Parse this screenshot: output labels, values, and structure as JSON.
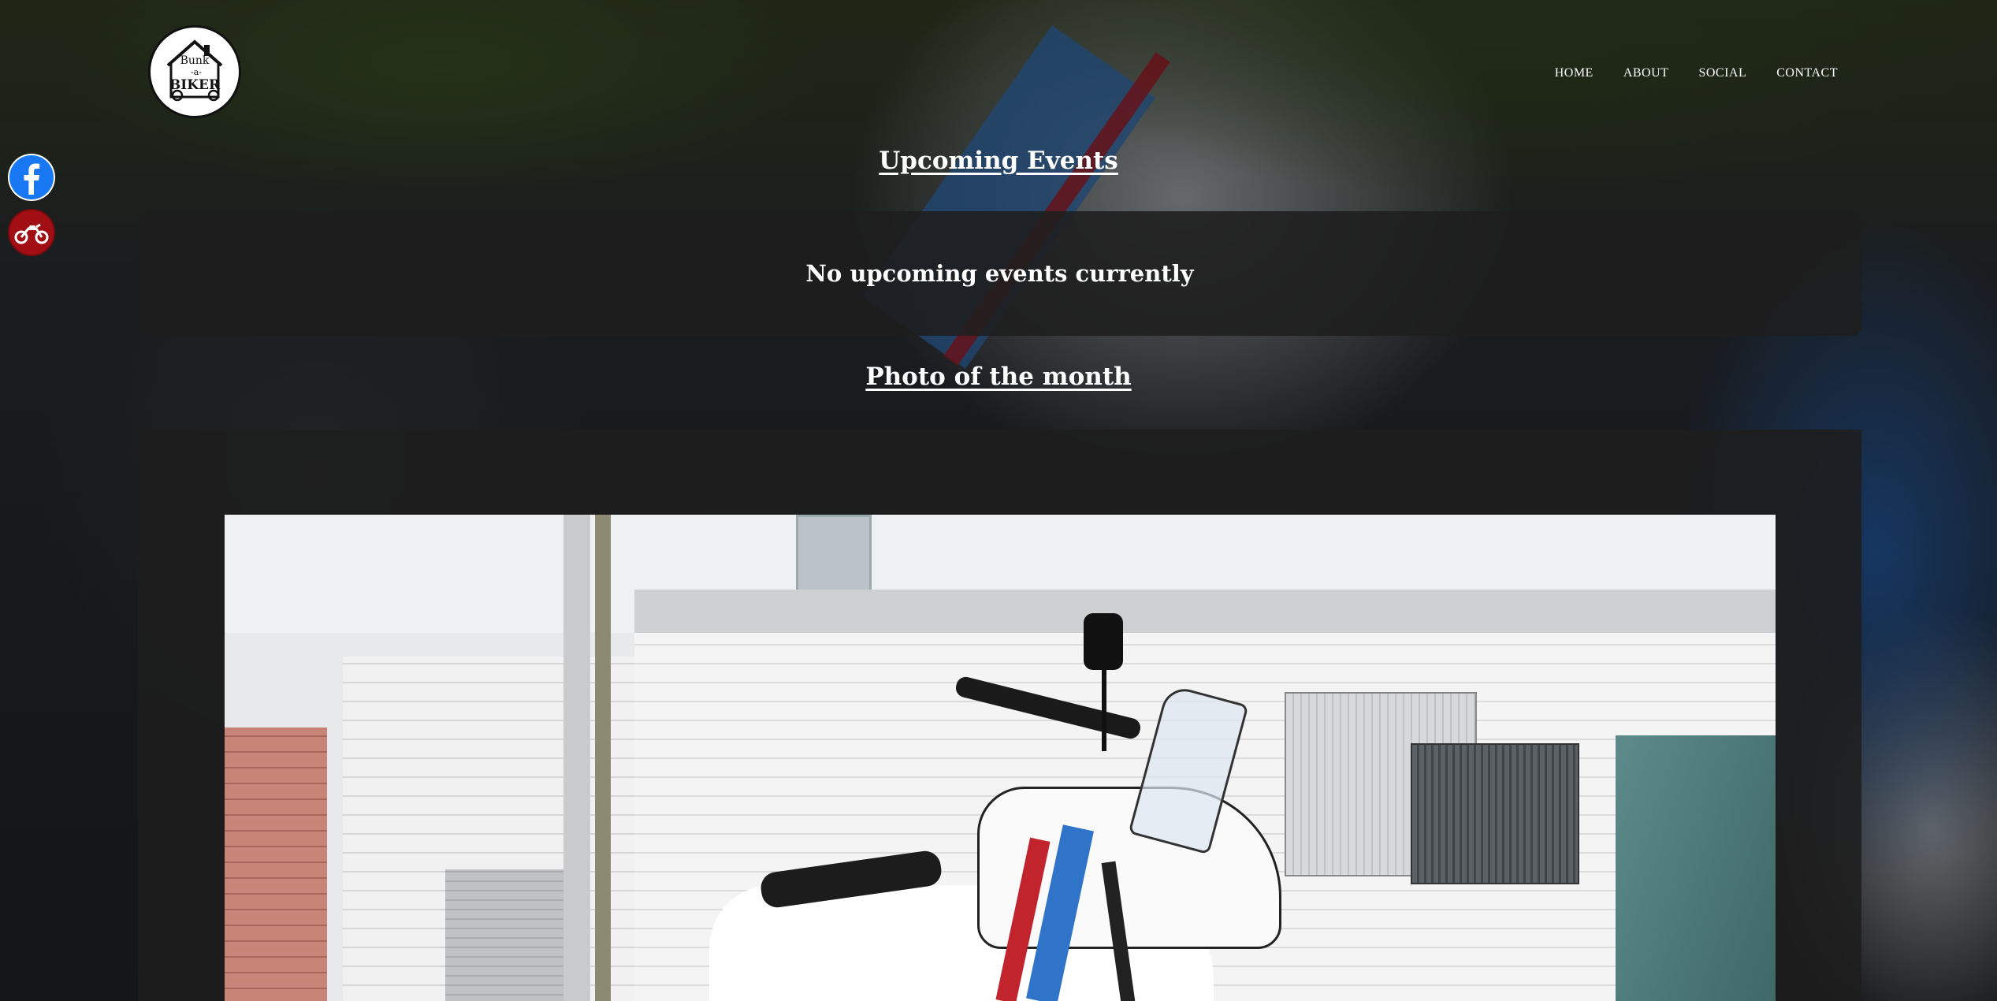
{
  "logo": {
    "line1": "Bunk",
    "line2": "-a-",
    "line3": "BIKER"
  },
  "nav": {
    "items": [
      {
        "label": "HOME"
      },
      {
        "label": "ABOUT"
      },
      {
        "label": "SOCIAL"
      },
      {
        "label": "CONTACT"
      }
    ]
  },
  "social": {
    "facebook_icon": "facebook-icon",
    "motorcycle_icon": "motorcycle-icon"
  },
  "events": {
    "title": "Upcoming Events",
    "empty_message": "No upcoming events currently"
  },
  "photo_of_month": {
    "title": "Photo of the month",
    "photo_subject": "Honda Africa Twin motorcycle parked by white brick building"
  },
  "colors": {
    "nav_text": "#ffffff",
    "panel_bg": "#1e1e1e",
    "facebook_blue": "#1877f2",
    "moto_red": "#a10e14"
  }
}
